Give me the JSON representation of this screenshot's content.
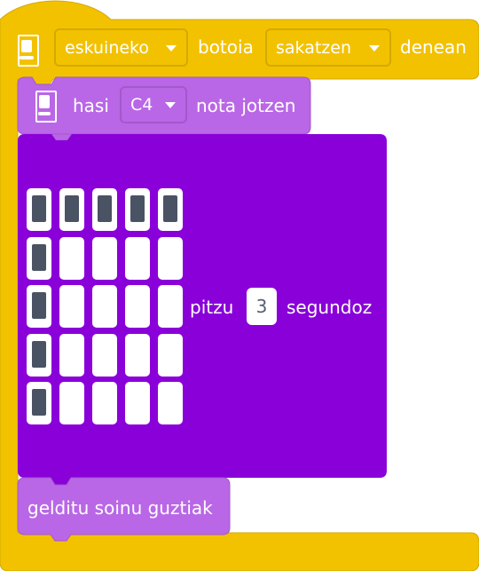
{
  "hat_block": {
    "button_select": "eskuineko",
    "label_button": "botoia",
    "action_select": "sakatzen",
    "label_when": "denean",
    "icon": "microbit-icon"
  },
  "start_note_block": {
    "label_start": "hasi",
    "note_select": "C4",
    "label_playing": "nota jotzen",
    "icon": "microbit-icon"
  },
  "led_block": {
    "pattern": [
      [
        1,
        1,
        1,
        1,
        1
      ],
      [
        1,
        0,
        0,
        0,
        0
      ],
      [
        1,
        0,
        0,
        0,
        0
      ],
      [
        1,
        0,
        0,
        0,
        0
      ],
      [
        1,
        0,
        0,
        0,
        0
      ]
    ],
    "label_light": "pitzu",
    "seconds_value": "3",
    "label_seconds": "segundoz"
  },
  "stop_block": {
    "label": "gelditu soinu guztiak"
  },
  "colors": {
    "event_yellow": "#f2c200",
    "event_border": "#d4a900",
    "sound_lavender": "#b967e6",
    "sound_border": "#a358ca",
    "display_purple": "#8a00d9",
    "led_off": "#ffffff",
    "led_on": "#4a5363"
  }
}
